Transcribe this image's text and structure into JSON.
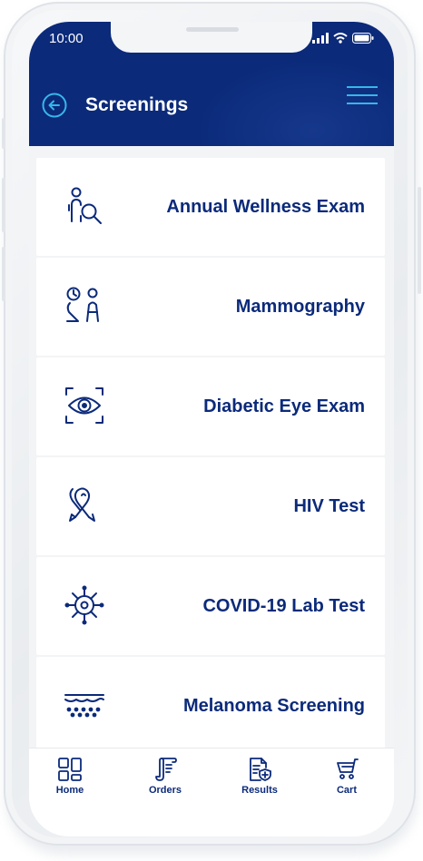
{
  "status_bar": {
    "time": "10:00"
  },
  "header": {
    "title": "Screenings"
  },
  "screenings": [
    {
      "label": "Annual Wellness Exam",
      "icon": "person-search-icon"
    },
    {
      "label": "Mammography",
      "icon": "mammography-icon"
    },
    {
      "label": "Diabetic Eye Exam",
      "icon": "eye-scan-icon"
    },
    {
      "label": "HIV Test",
      "icon": "awareness-ribbon-icon"
    },
    {
      "label": "COVID-19 Lab Test",
      "icon": "virus-icon"
    },
    {
      "label": "Melanoma Screening",
      "icon": "skin-layer-icon"
    }
  ],
  "tabs": [
    {
      "label": "Home",
      "icon": "grid-icon"
    },
    {
      "label": "Orders",
      "icon": "scroll-icon"
    },
    {
      "label": "Results",
      "icon": "document-shield-icon"
    },
    {
      "label": "Cart",
      "icon": "cart-icon"
    }
  ],
  "colors": {
    "header_bg": "#0b2a7a",
    "accent": "#37b6ea",
    "text": "#0b2a7a"
  }
}
